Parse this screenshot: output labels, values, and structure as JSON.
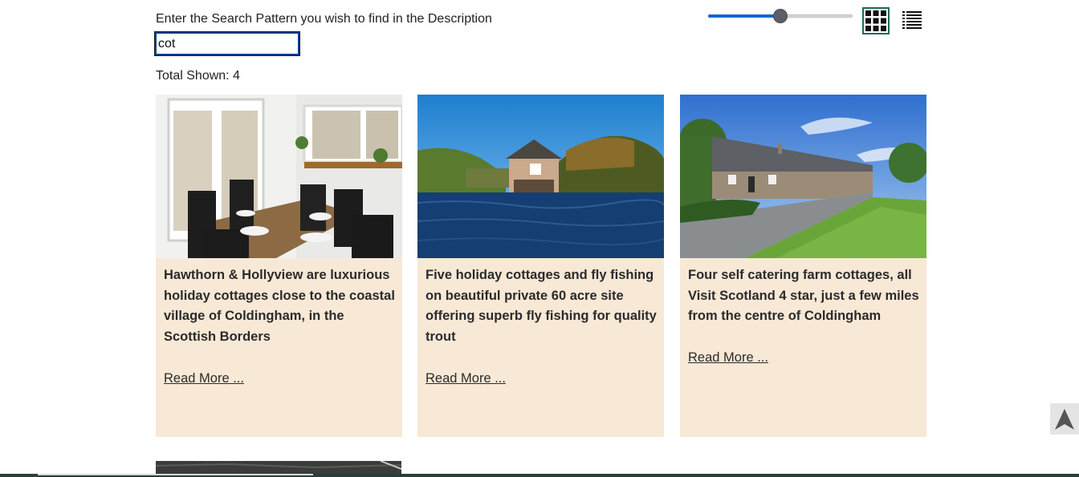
{
  "search": {
    "label": "Enter the Search Pattern you wish to find in the Description",
    "value": "cot"
  },
  "total": {
    "text": "Total Shown: 4"
  },
  "size_slider": {
    "level_fraction": 0.5
  },
  "view_toggle": {
    "grid_icon": "grid-view-icon",
    "list_icon": "list-view-icon",
    "active": "grid"
  },
  "cards": [
    {
      "image": "dining-room-photo",
      "description": "Hawthorn & Hollyview are luxurious holiday cottages close to the coastal village of Coldingham, in the Scottish Borders",
      "read_more": "Read More ..."
    },
    {
      "image": "boathouse-on-loch-photo",
      "description": "Five holiday cottages and fly fishing on beautiful private 60 acre site offering superb fly fishing for quality trout",
      "read_more": "Read More ..."
    },
    {
      "image": "farm-cottages-row-photo",
      "description": "Four self catering farm cottages, all Visit Scotland 4 star, just a few miles from the centre of Coldingham",
      "read_more": "Read More ..."
    }
  ],
  "back_to_top": {
    "icon": "arrow-up-icon"
  },
  "colors": {
    "card_bg": "#f8e8d6",
    "slider_fill": "#1565d8",
    "grid_border": "#1e6b5a"
  }
}
